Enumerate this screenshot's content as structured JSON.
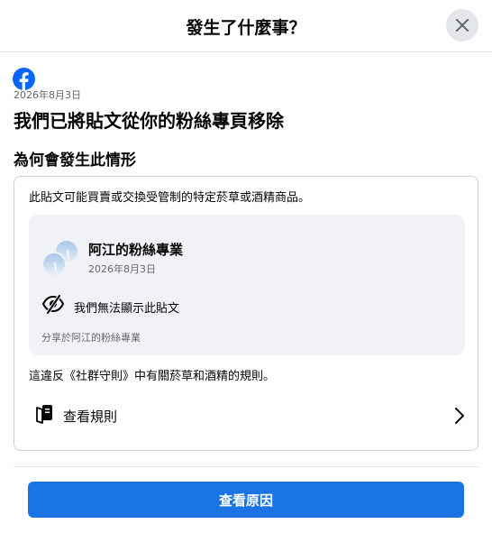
{
  "dialog": {
    "title": "發生了什麼事？",
    "close_icon": "close-icon"
  },
  "notice": {
    "logo_icon": "facebook-logo-icon",
    "date": "2026年8月3日",
    "title": "我們已將貼文從你的粉絲專頁移除"
  },
  "reason": {
    "heading": "為何會發生此情形",
    "description": "此貼文可能買賣或交換受管制的特定菸草或酒精商品。",
    "post": {
      "page_name": "阿江的粉絲專業",
      "date": "2026年8月3日",
      "hidden_icon": "eye-slash-icon",
      "hidden_text": "我們無法顯示此貼文",
      "shared_text": "分享於阿江的粉絲專業"
    },
    "violation_text": "這違反《社群守則》中有關菸草和酒精的規則。",
    "rules_link": {
      "icon": "rulebook-icon",
      "label": "查看規則",
      "chevron_icon": "chevron-right-icon"
    }
  },
  "actions": {
    "primary_label": "查看原因"
  },
  "colors": {
    "brand_blue": "#1b74e4",
    "facebook_blue": "#0866ff",
    "secondary_text": "#65676b",
    "card_background": "#f0f2f5",
    "divider": "#e4e6eb"
  }
}
